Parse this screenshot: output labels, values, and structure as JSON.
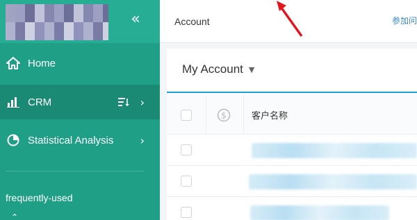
{
  "sidebar": {
    "collapse_icon": "double-chevron-left-icon",
    "items": [
      {
        "label": "Home",
        "icon": "home-icon"
      },
      {
        "label": "CRM",
        "icon": "bar-chart-icon"
      },
      {
        "label": "Statistical Analysis",
        "icon": "pie-chart-icon"
      }
    ],
    "section_label": "frequently-used"
  },
  "header": {
    "title": "Account",
    "link_label": "参加问"
  },
  "panel": {
    "view_select_label": "My Account"
  },
  "table": {
    "columns": [
      "",
      "",
      "客户名称"
    ],
    "rows_visible": 3
  },
  "colors": {
    "sidebar_bg": "#1f9f86",
    "sidebar_active": "#1b8a75",
    "accent_blue": "#1aa0d6",
    "arrow_red": "#e3161f"
  }
}
